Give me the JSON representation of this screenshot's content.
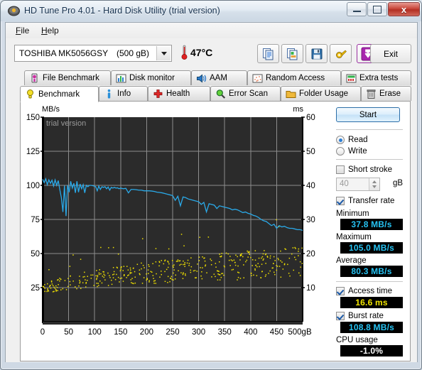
{
  "window": {
    "title": "HD Tune Pro 4.01 - Hard Disk Utility (trial version)",
    "icon": "hard-disk-icon",
    "minimize": "—",
    "maximize": "□",
    "close": "x"
  },
  "menu": {
    "items": [
      "File",
      "Help"
    ]
  },
  "toolbar": {
    "drive": {
      "name": "TOSHIBA MK5056GSY",
      "capacity": "(500 gB)"
    },
    "temperature": "47°C",
    "buttons": [
      {
        "name": "copy-icon"
      },
      {
        "name": "copy-image-icon"
      },
      {
        "name": "save-icon"
      },
      {
        "name": "settings-icon"
      },
      {
        "name": "download-icon"
      }
    ],
    "exit_label": "Exit"
  },
  "tabs": {
    "row1": [
      {
        "label": "File Benchmark",
        "icon": "file-benchmark-icon",
        "active": false
      },
      {
        "label": "Disk monitor",
        "icon": "disk-monitor-icon",
        "active": false
      },
      {
        "label": "AAM",
        "icon": "speaker-icon",
        "active": false
      },
      {
        "label": "Random Access",
        "icon": "random-access-icon",
        "active": false
      },
      {
        "label": "Extra tests",
        "icon": "extra-tests-icon",
        "active": false
      }
    ],
    "row2": [
      {
        "label": "Benchmark",
        "icon": "bulb-icon",
        "active": true
      },
      {
        "label": "Info",
        "icon": "info-icon",
        "active": false
      },
      {
        "label": "Health",
        "icon": "health-cross-icon",
        "active": false
      },
      {
        "label": "Error Scan",
        "icon": "magnifier-icon",
        "active": false
      },
      {
        "label": "Folder Usage",
        "icon": "folder-icon",
        "active": false
      },
      {
        "label": "Erase",
        "icon": "trash-icon",
        "active": false
      }
    ]
  },
  "panel": {
    "start_label": "Start",
    "mode": {
      "read_label": "Read",
      "write_label": "Write",
      "selected": "Read"
    },
    "short_stroke": {
      "label": "Short stroke",
      "checked": false,
      "value": "40",
      "unit": "gB"
    },
    "transfer_rate": {
      "label": "Transfer rate",
      "checked": true
    },
    "minimum": {
      "label": "Minimum",
      "value": "37.8 MB/s"
    },
    "maximum": {
      "label": "Maximum",
      "value": "105.0 MB/s"
    },
    "average": {
      "label": "Average",
      "value": "80.3 MB/s"
    },
    "access_time": {
      "label": "Access time",
      "checked": true,
      "value": "16.6 ms"
    },
    "burst_rate": {
      "label": "Burst rate",
      "checked": true,
      "value": "108.8 MB/s"
    },
    "cpu_usage": {
      "label": "CPU usage",
      "value": "-1.0%"
    }
  },
  "chart_data": {
    "type": "line",
    "title": "",
    "watermark": "trial version",
    "xlabel": "gB",
    "xlabel_suffix": "gB",
    "ylabel_left": "MB/s",
    "ylabel_right": "ms",
    "xlim": [
      0,
      500
    ],
    "ylim_left": [
      0,
      150
    ],
    "ylim_right": [
      0,
      60
    ],
    "xticks": [
      0,
      50,
      100,
      150,
      200,
      250,
      300,
      350,
      400,
      450,
      500
    ],
    "yticks_left": [
      25,
      50,
      75,
      100,
      125,
      150
    ],
    "yticks_right": [
      10,
      20,
      30,
      40,
      50,
      60
    ],
    "grid": true,
    "plot_bg": "#2b2b2b",
    "series": [
      {
        "name": "Transfer rate",
        "type": "line",
        "color": "#2aa9e8",
        "axis": "left",
        "unit": "MB/s",
        "x": [
          0,
          3,
          6,
          9,
          12,
          15,
          18,
          21,
          24,
          27,
          30,
          33,
          36,
          39,
          42,
          45,
          48,
          51,
          54,
          57,
          60,
          63,
          66,
          69,
          72,
          75,
          78,
          81,
          84,
          87,
          90,
          93,
          96,
          99,
          102,
          105,
          108,
          111,
          114,
          117,
          120,
          123,
          126,
          129,
          132,
          135,
          138,
          141,
          144,
          147,
          150,
          155,
          160,
          165,
          170,
          175,
          180,
          185,
          190,
          195,
          200,
          205,
          210,
          215,
          220,
          225,
          230,
          235,
          240,
          245,
          250,
          255,
          260,
          265,
          270,
          275,
          280,
          285,
          290,
          295,
          300,
          305,
          310,
          315,
          320,
          325,
          330,
          335,
          340,
          345,
          350,
          355,
          360,
          365,
          370,
          375,
          380,
          385,
          390,
          395,
          400,
          405,
          410,
          415,
          420,
          425,
          430,
          435,
          440,
          445,
          450,
          455,
          460,
          465,
          470,
          475,
          480,
          485,
          490,
          495,
          500
        ],
        "y": [
          104.5,
          102.0,
          104.8,
          100.5,
          104.0,
          101.5,
          103.8,
          99.5,
          104.0,
          100.0,
          103.5,
          97.0,
          91.0,
          80.5,
          99.8,
          77.5,
          100.2,
          95.0,
          103.0,
          98.0,
          101.5,
          94.5,
          103.0,
          95.0,
          101.0,
          97.5,
          100.5,
          94.5,
          100.0,
          99.0,
          100.0,
          100.0,
          99.8,
          99.5,
          99.0,
          96.0,
          99.5,
          97.0,
          99.0,
          98.5,
          99.0,
          97.5,
          98.8,
          96.5,
          98.5,
          98.0,
          98.5,
          98.0,
          98.2,
          97.5,
          98.0,
          97.5,
          97.8,
          94.5,
          97.0,
          97.0,
          96.8,
          96.5,
          96.5,
          96.0,
          96.0,
          96.0,
          95.8,
          95.5,
          95.0,
          94.8,
          94.5,
          94.0,
          93.5,
          93.0,
          92.5,
          89.0,
          92.0,
          85.0,
          91.5,
          91.0,
          90.0,
          89.5,
          89.0,
          88.5,
          88.0,
          86.0,
          87.5,
          80.5,
          86.5,
          86.0,
          85.5,
          83.0,
          85.0,
          84.5,
          84.0,
          83.5,
          83.0,
          82.0,
          82.5,
          82.0,
          81.0,
          80.0,
          80.5,
          79.5,
          79.0,
          78.0,
          77.5,
          76.5,
          75.0,
          74.0,
          73.5,
          72.0,
          70.5,
          71.5,
          68.5,
          70.5,
          69.5,
          70.0,
          69.0,
          68.5,
          68.5,
          68.0,
          67.5,
          67.5,
          67.0
        ]
      },
      {
        "name": "Access time",
        "type": "scatter",
        "color": "#f0e000",
        "axis": "right",
        "unit": "ms",
        "points_approx": 420,
        "mean_ms": 16.6,
        "spread_ms": [
          4.0,
          22.0
        ],
        "note": "Yellow access-time dots scattered across the full 0-500 gB span, band widening and drifting upward with offset."
      }
    ]
  }
}
